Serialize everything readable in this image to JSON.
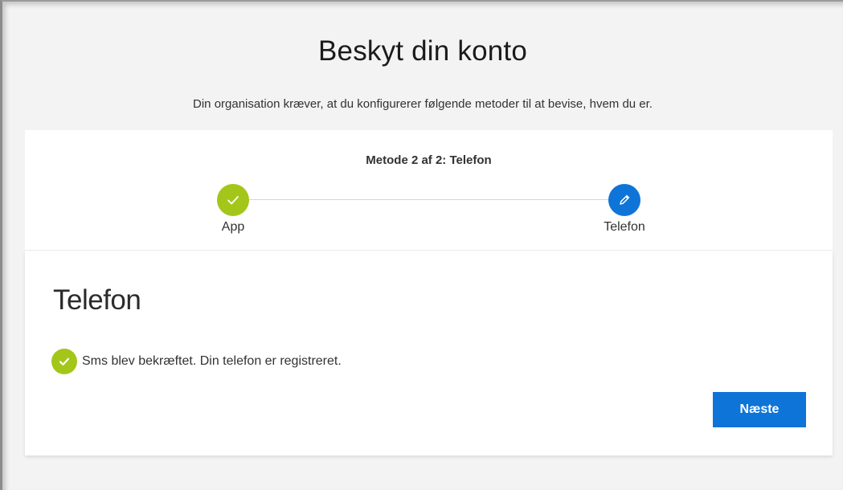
{
  "page": {
    "title": "Beskyt din konto",
    "subtitle": "Din organisation kræver, at du konfigurerer følgende metoder til at bevise, hvem du er."
  },
  "progress": {
    "step_title": "Metode 2 af 2: Telefon",
    "steps": [
      {
        "label": "App",
        "state": "completed",
        "icon": "check-icon",
        "color": "#a4c61a"
      },
      {
        "label": "Telefon",
        "state": "current",
        "icon": "pencil-icon",
        "color": "#0f74d8"
      }
    ]
  },
  "section": {
    "title": "Telefon",
    "status_icon": "check-circle-icon",
    "status_text": "Sms blev bekræftet. Din telefon er registreret.",
    "next_label": "Næste"
  },
  "colors": {
    "accent": "#0f74d8",
    "success": "#a4c61a",
    "background": "#f3f3f3"
  }
}
